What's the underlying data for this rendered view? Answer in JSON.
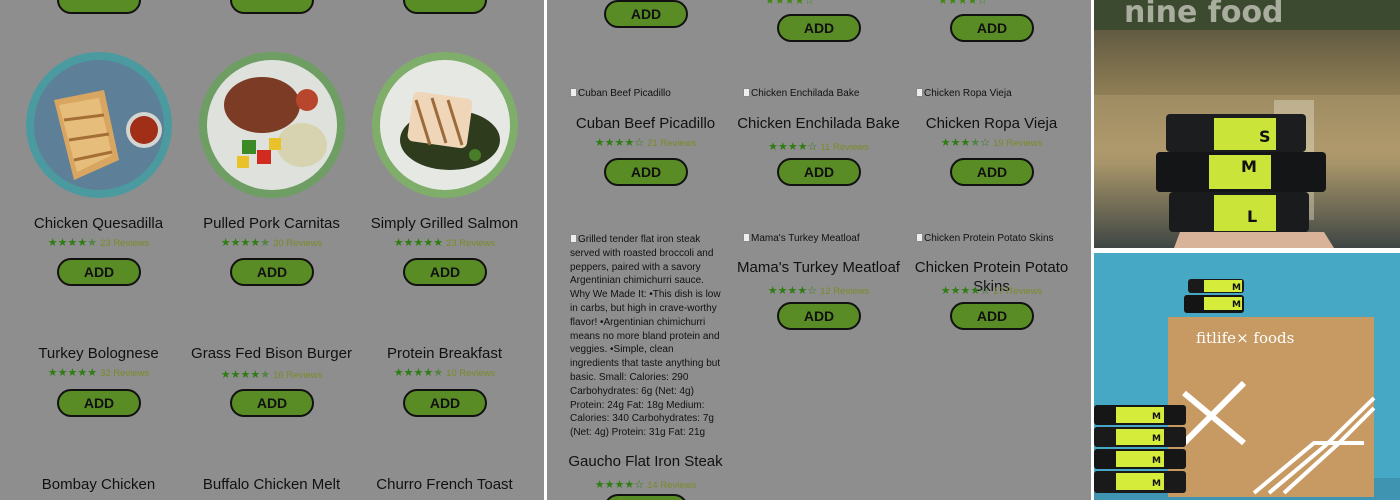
{
  "left_panel": {
    "top_buttons": [
      "",
      "",
      ""
    ],
    "items": [
      {
        "name": "Chicken Quesadilla",
        "rating": 4.5,
        "reviews": "23 Reviews",
        "button": "ADD"
      },
      {
        "name": "Pulled Pork Carnitas",
        "rating": 4.5,
        "reviews": "30 Reviews",
        "button": "ADD"
      },
      {
        "name": "Simply Grilled Salmon",
        "rating": 5,
        "reviews": "23 Reviews",
        "button": "ADD"
      },
      {
        "name": "Turkey Bolognese",
        "rating": 5,
        "reviews": "32 Reviews",
        "button": "ADD"
      },
      {
        "name": "Grass Fed Bison Burger",
        "rating": 4.5,
        "reviews": "16 Reviews",
        "button": "ADD"
      },
      {
        "name": "Protein Breakfast",
        "rating": 4.5,
        "reviews": "10 Reviews",
        "button": "ADD"
      },
      {
        "name": "Bombay Chicken",
        "rating": 0,
        "reviews": "",
        "button": ""
      },
      {
        "name": "Buffalo Chicken Melt",
        "rating": 0,
        "reviews": "",
        "button": ""
      },
      {
        "name": "Churro French Toast",
        "rating": 0,
        "reviews": "",
        "button": ""
      }
    ]
  },
  "mid_panel": {
    "top_items": [
      {
        "button": "ADD"
      },
      {
        "button": "ADD"
      },
      {
        "button": "ADD"
      }
    ],
    "items": [
      {
        "alt": "Cuban Beef Picadillo",
        "name": "Cuban Beef Picadillo",
        "rating": 4,
        "reviews": "21 Reviews",
        "button": "ADD"
      },
      {
        "alt": "Chicken Enchilada Bake",
        "name": "Chicken Enchilada Bake",
        "rating": 4,
        "reviews": "11 Reviews",
        "button": "ADD"
      },
      {
        "alt": "Chicken Ropa Vieja",
        "name": "Chicken Ropa Vieja",
        "rating": 3.5,
        "reviews": "19 Reviews",
        "button": "ADD"
      },
      {
        "alt": "Grilled tender flat iron steak served with roasted broccoli and peppers, paired with a savory Argentinian chimichurri sauce. Why We Made It: •This dish is low in carbs, but high in crave-worthy flavor! •Argentinian chimichurri means no more bland protein and veggies. •Simple, clean ingredients that taste anything but basic. Small: Calories: 290 Carbohydrates: 6g (Net: 4g) Protein: 24g Fat: 18g Medium: Calories: 340 Carbohydrates: 7g (Net: 4g) Protein: 31g Fat: 21g",
        "name": "Gaucho Flat Iron Steak",
        "rating": 4,
        "reviews": "14 Reviews",
        "button": ""
      },
      {
        "alt": "Mama's Turkey Meatloaf",
        "name": "Mama's Turkey Meatloaf",
        "rating": 4,
        "reviews": "12 Reviews",
        "button": "ADD"
      },
      {
        "alt": "Chicken Protein Potato Skins",
        "name": "Chicken Protein Potato Skins",
        "rating": 4,
        "reviews": "17 Reviews",
        "button": "ADD"
      }
    ]
  },
  "photos": {
    "top": {
      "sizes": [
        "S",
        "M",
        "L"
      ],
      "sign_text": "nine   food"
    },
    "bottom": {
      "brand": "fitlife foods",
      "brand_left": "fitlife",
      "brand_x": "×",
      "brand_right": "foods",
      "tray_letter": "M"
    }
  },
  "colors": {
    "button_green": "#5a8c26",
    "star_green": "#3e8a10",
    "overlay_gray": "#8e8e8e",
    "lime": "#c8e83a"
  }
}
